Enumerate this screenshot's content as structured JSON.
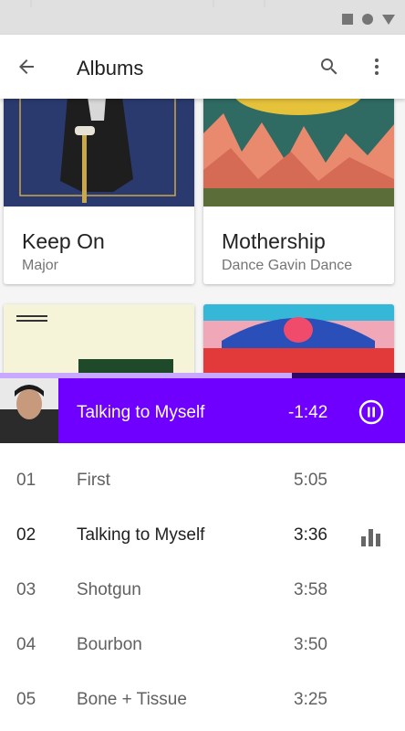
{
  "app_bar": {
    "title": "Albums"
  },
  "albums": [
    {
      "title": "Keep On",
      "artist": "Major"
    },
    {
      "title": "Mothership",
      "artist": "Dance Gavin Dance"
    },
    {
      "art_text": ""
    },
    {
      "art_text": ""
    }
  ],
  "now_playing": {
    "title": "Talking to Myself",
    "remaining": "-1:42",
    "progress_fraction": 0.72
  },
  "tracks": [
    {
      "num": "01",
      "name": "First",
      "duration": "5:05",
      "active": false
    },
    {
      "num": "02",
      "name": "Talking to Myself",
      "duration": "3:36",
      "active": true
    },
    {
      "num": "03",
      "name": "Shotgun",
      "duration": "3:58",
      "active": false
    },
    {
      "num": "04",
      "name": "Bourbon",
      "duration": "3:50",
      "active": false
    },
    {
      "num": "05",
      "name": "Bone + Tissue",
      "duration": "3:25",
      "active": false
    }
  ],
  "colors": {
    "accent": "#6f00ff",
    "status_bar": "#e0e0e0"
  },
  "icons": [
    "back-arrow-icon",
    "search-icon",
    "more-vert-icon",
    "pause-icon",
    "equalizer-icon"
  ]
}
